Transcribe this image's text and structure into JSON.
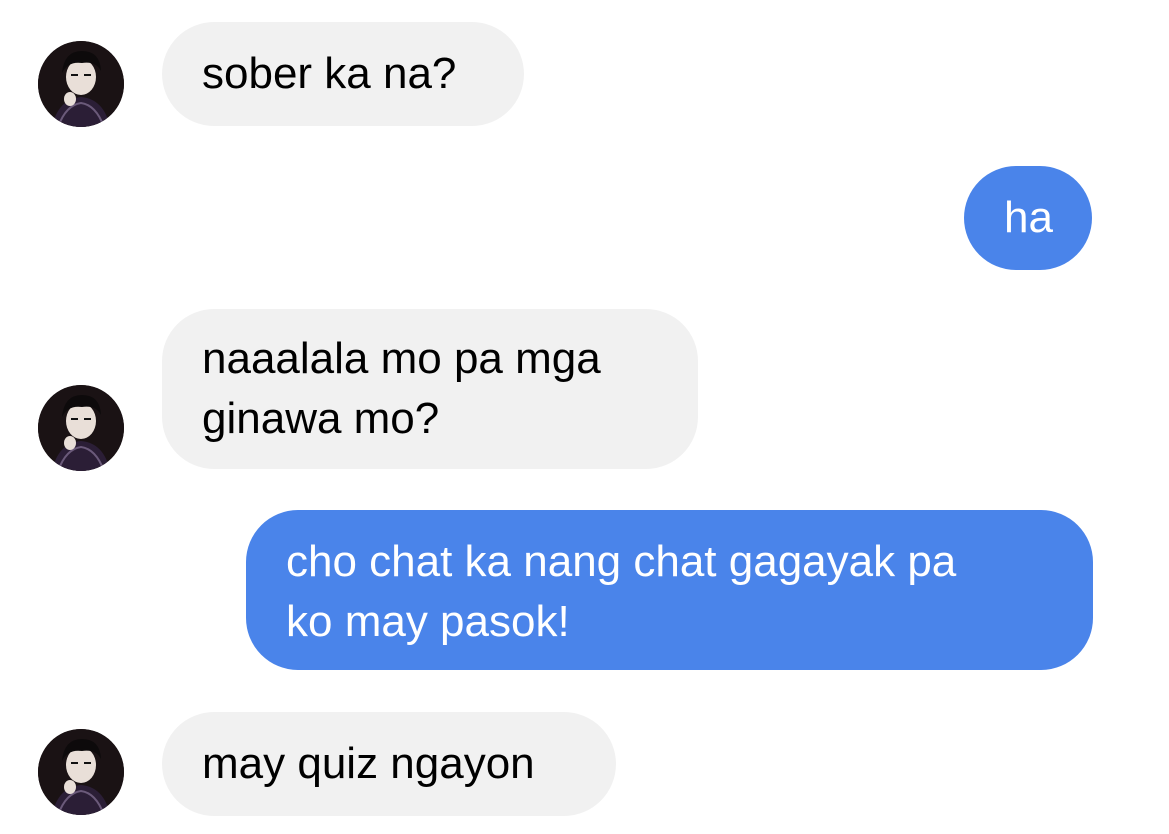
{
  "conversation": {
    "messages": [
      {
        "direction": "incoming",
        "lines": [
          "sober ka na?"
        ]
      },
      {
        "direction": "outgoing",
        "lines": [
          "ha"
        ]
      },
      {
        "direction": "incoming",
        "lines": [
          "naaalala mo pa mga",
          "ginawa mo?"
        ]
      },
      {
        "direction": "outgoing",
        "lines": [
          "cho chat ka nang chat gagayak pa",
          "ko may pasok!"
        ]
      },
      {
        "direction": "incoming",
        "lines": [
          "may quiz ngayon"
        ]
      }
    ]
  },
  "colors": {
    "incoming_bubble": "#f1f1f1",
    "outgoing_bubble": "#4a84ea",
    "incoming_text": "#000000",
    "outgoing_text": "#ffffff",
    "background": "#ffffff"
  },
  "icons": {
    "contact_avatar": "contact-avatar-icon"
  }
}
